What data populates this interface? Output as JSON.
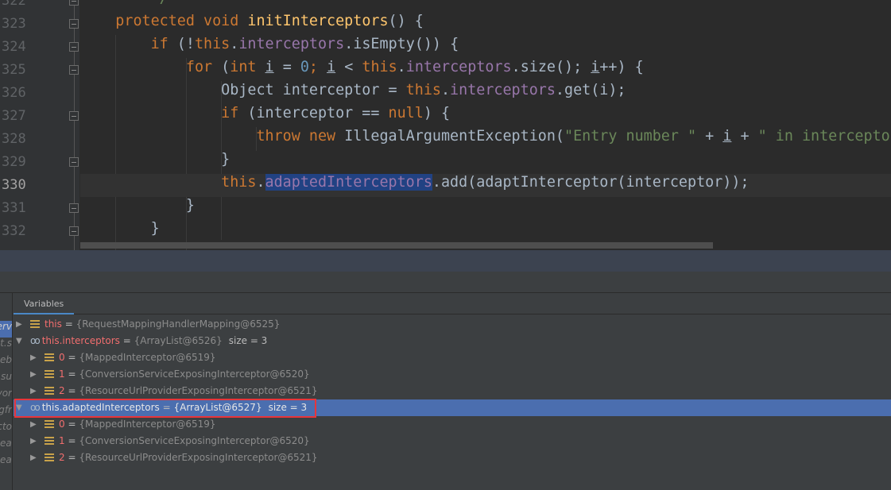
{
  "editor": {
    "lines": [
      {
        "n": "322",
        "tokens": [
          [
            "        ",
            "t"
          ],
          [
            "*/",
            "str"
          ]
        ]
      },
      {
        "n": "323",
        "tokens": [
          [
            "    ",
            ""
          ],
          [
            "protected void ",
            "kw"
          ],
          [
            "initInterceptors",
            "fn"
          ],
          [
            "() {",
            ""
          ]
        ]
      },
      {
        "n": "324",
        "tokens": [
          [
            "        ",
            ""
          ],
          [
            "if ",
            "kw"
          ],
          [
            "(!",
            ""
          ],
          [
            "this",
            "kw"
          ],
          [
            ".",
            ""
          ],
          [
            "interceptors",
            "fld"
          ],
          [
            ".isEmpty()) {",
            ""
          ]
        ]
      },
      {
        "n": "325",
        "tokens": [
          [
            "            ",
            ""
          ],
          [
            "for ",
            "kw"
          ],
          [
            "(",
            ""
          ],
          [
            "int ",
            "kw"
          ],
          [
            "i",
            "u"
          ],
          [
            " = ",
            ""
          ],
          [
            "0",
            "num"
          ],
          [
            "; ",
            "kw"
          ],
          [
            "i",
            "u"
          ],
          [
            " < ",
            ""
          ],
          [
            "this",
            "kw"
          ],
          [
            ".",
            ""
          ],
          [
            "interceptors",
            "fld"
          ],
          [
            ".size(); ",
            ""
          ],
          [
            "i",
            "u"
          ],
          [
            "++) {",
            ""
          ]
        ]
      },
      {
        "n": "326",
        "tokens": [
          [
            "                Object interceptor = ",
            ""
          ],
          [
            "this",
            "kw"
          ],
          [
            ".",
            ""
          ],
          [
            "interceptors",
            "fld"
          ],
          [
            ".get(i);",
            ""
          ]
        ]
      },
      {
        "n": "327",
        "tokens": [
          [
            "                ",
            ""
          ],
          [
            "if ",
            "kw"
          ],
          [
            "(interceptor == ",
            ""
          ],
          [
            "null",
            "kw"
          ],
          [
            ") {",
            ""
          ]
        ]
      },
      {
        "n": "328",
        "tokens": [
          [
            "                    ",
            ""
          ],
          [
            "throw new ",
            "kw"
          ],
          [
            "IllegalArgumentException(",
            ""
          ],
          [
            "\"Entry number \"",
            "str"
          ],
          [
            " + ",
            ""
          ],
          [
            "i",
            "u"
          ],
          [
            " + ",
            ""
          ],
          [
            "\" in interceptors",
            "str"
          ]
        ]
      },
      {
        "n": "329",
        "tokens": [
          [
            "                }",
            ""
          ]
        ]
      },
      {
        "n": "330",
        "tokens": [
          [
            "                ",
            ""
          ],
          [
            "this",
            "kw"
          ],
          [
            ".",
            ""
          ],
          [
            "adaptedInterceptors",
            "fld sel"
          ],
          [
            ".add(adaptInterceptor(interceptor));",
            ""
          ]
        ]
      },
      {
        "n": "331",
        "tokens": [
          [
            "            }",
            ""
          ]
        ]
      },
      {
        "n": "332",
        "tokens": [
          [
            "        }",
            ""
          ]
        ]
      }
    ],
    "current_line": "330"
  },
  "debugger": {
    "tab_variables": "Variables",
    "frames": [
      "erv",
      "xt.s",
      "eb.",
      "t.su",
      "vor",
      "gfr",
      "acto",
      "ea",
      "ea"
    ],
    "variables": [
      {
        "depth": 0,
        "icon": "field-icon",
        "expanded": false,
        "name": "this",
        "value": "{RequestMappingHandlerMapping@6525}",
        "size": ""
      },
      {
        "depth": 0,
        "icon": "watch-icon",
        "expanded": true,
        "name": "this.interceptors",
        "value": "{ArrayList@6526}",
        "size": "size = 3"
      },
      {
        "depth": 1,
        "icon": "field-icon",
        "expanded": false,
        "name": "0",
        "value": "{MappedInterceptor@6519}",
        "size": ""
      },
      {
        "depth": 1,
        "icon": "field-icon",
        "expanded": false,
        "name": "1",
        "value": "{ConversionServiceExposingInterceptor@6520}",
        "size": ""
      },
      {
        "depth": 1,
        "icon": "field-icon",
        "expanded": false,
        "name": "2",
        "value": "{ResourceUrlProviderExposingInterceptor@6521}",
        "size": ""
      },
      {
        "depth": 0,
        "icon": "watch-icon",
        "expanded": true,
        "selected": true,
        "name": "this.adaptedInterceptors",
        "value": "{ArrayList@6527}",
        "size": "size = 3"
      },
      {
        "depth": 1,
        "icon": "field-icon",
        "expanded": false,
        "name": "0",
        "value": "{MappedInterceptor@6519}",
        "size": ""
      },
      {
        "depth": 1,
        "icon": "field-icon",
        "expanded": false,
        "name": "1",
        "value": "{ConversionServiceExposingInterceptor@6520}",
        "size": ""
      },
      {
        "depth": 1,
        "icon": "field-icon",
        "expanded": false,
        "name": "2",
        "value": "{ResourceUrlProviderExposingInterceptor@6521}",
        "size": ""
      }
    ]
  },
  "colors": {
    "keyword": "#cc7832",
    "field": "#9876aa",
    "string": "#6a8759",
    "number": "#6897bb",
    "selection": "#4b6eaf",
    "annotation_box": "#e8353a"
  }
}
